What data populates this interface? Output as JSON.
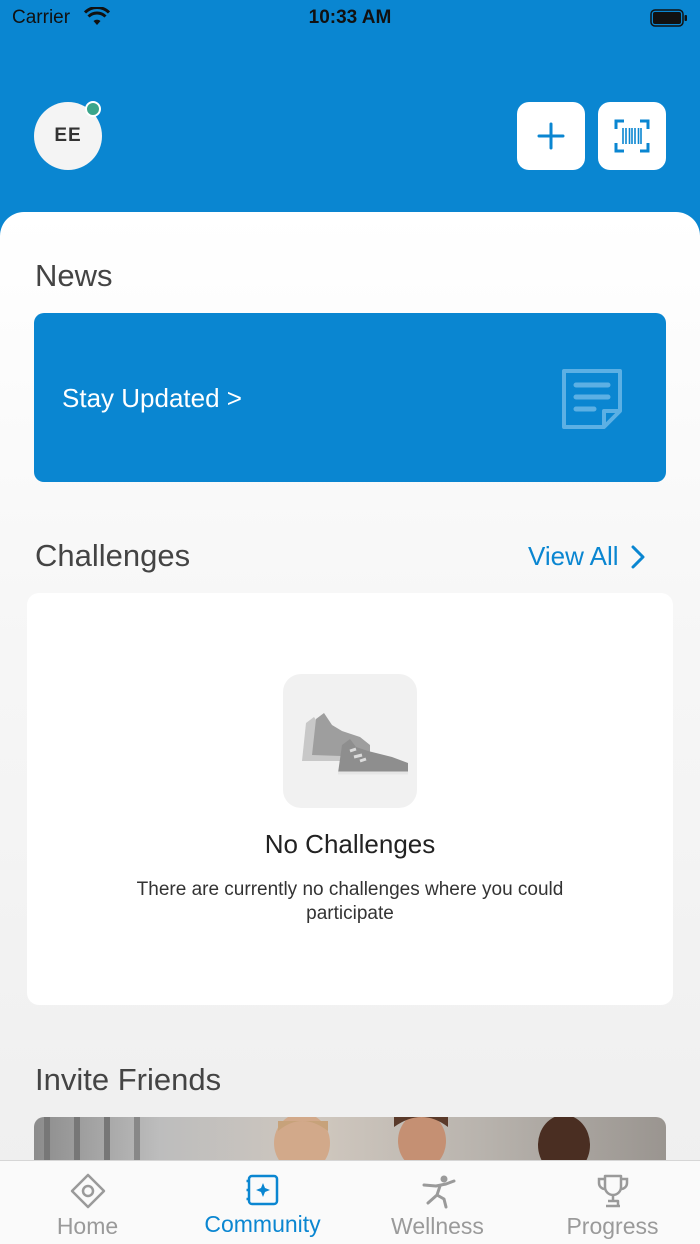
{
  "status_bar": {
    "carrier": "Carrier",
    "time": "10:33 AM"
  },
  "header": {
    "avatar_initials": "EE"
  },
  "news": {
    "title": "News",
    "card_label": "Stay Updated >"
  },
  "challenges": {
    "title": "Challenges",
    "view_all": "View All",
    "empty_title": "No Challenges",
    "empty_description": "There are currently no challenges where you could participate"
  },
  "invite": {
    "title": "Invite Friends"
  },
  "tabs": [
    {
      "label": "Home",
      "icon": "home-icon"
    },
    {
      "label": "Community",
      "icon": "community-icon",
      "active": true
    },
    {
      "label": "Wellness",
      "icon": "wellness-icon"
    },
    {
      "label": "Progress",
      "icon": "trophy-icon"
    }
  ],
  "colors": {
    "brand": "#0a86d1",
    "status_dot": "#3aa58b"
  }
}
